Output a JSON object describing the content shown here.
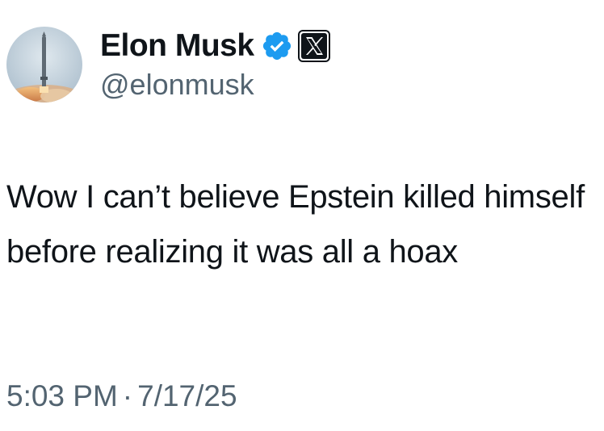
{
  "user": {
    "display_name": "Elon Musk",
    "handle": "@elonmusk",
    "verified_badge": "verified-badge-icon",
    "affiliation_badge": "x-logo-icon",
    "badge_color": "#1d9bf0"
  },
  "tweet": {
    "text": "Wow I can’t believe Epstein killed himself before realizing it was all a hoax",
    "time": "5:03 PM",
    "separator": "·",
    "date": "7/17/25"
  },
  "colors": {
    "text_primary": "#0f1419",
    "text_secondary": "#536471"
  }
}
